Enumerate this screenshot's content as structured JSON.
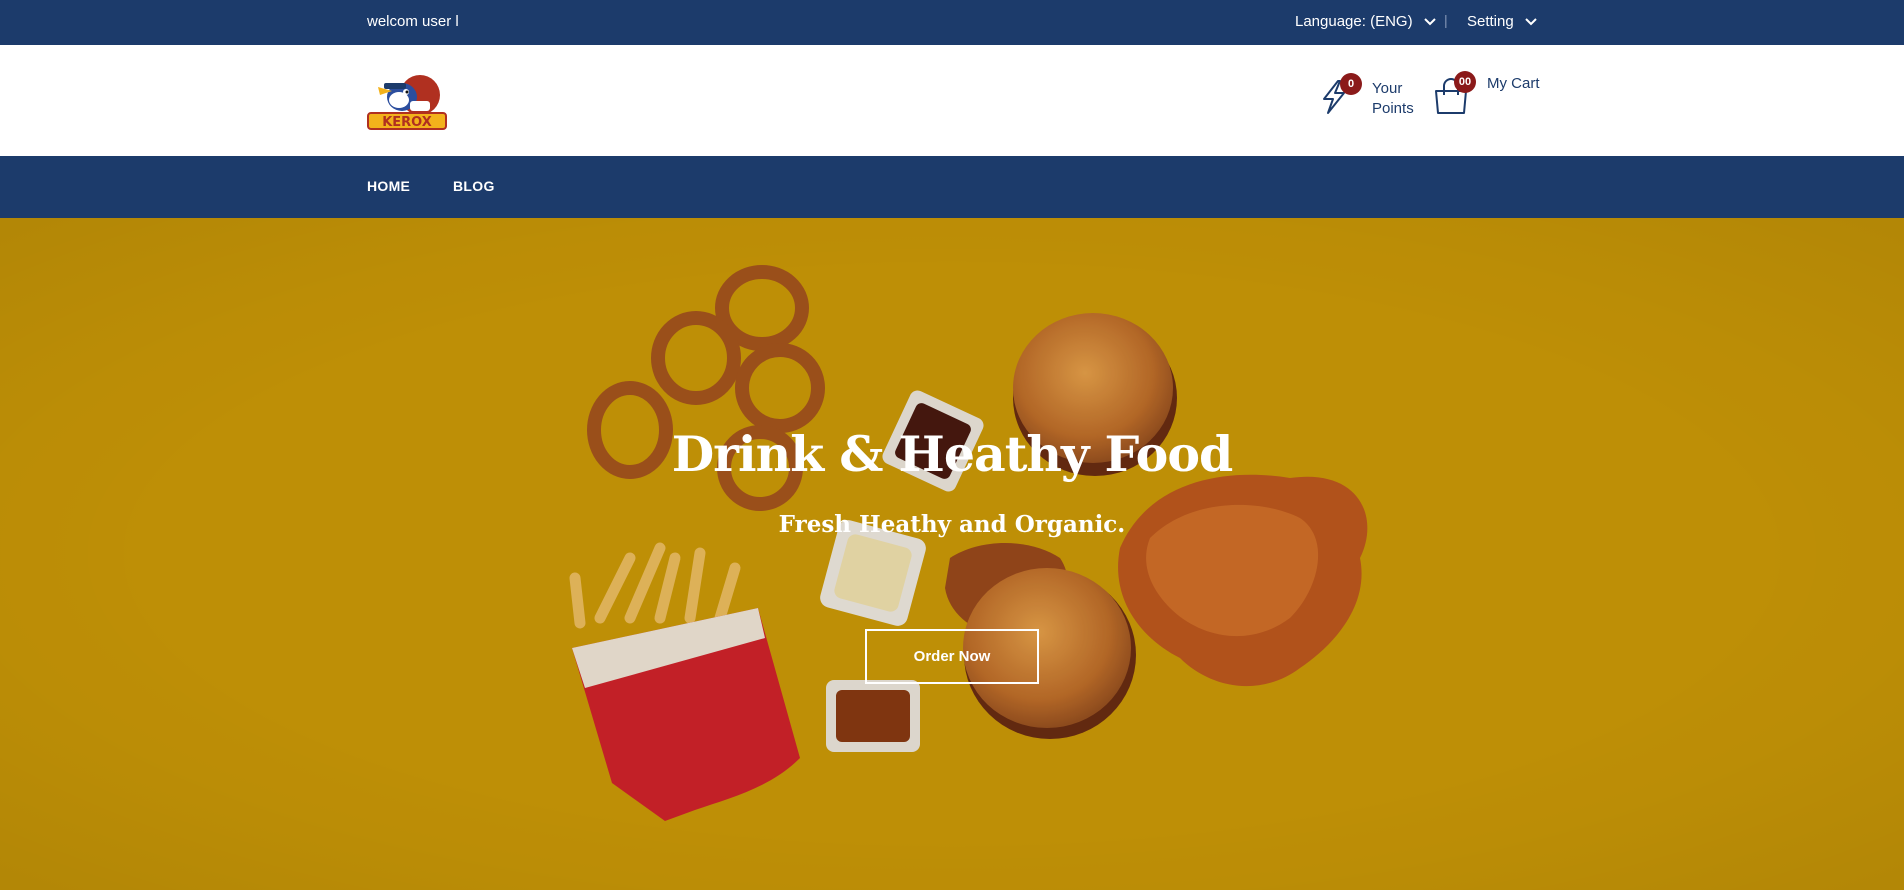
{
  "topbar": {
    "welcome": "welcom user l",
    "language": "Language: (ENG)",
    "separator": "|",
    "setting": "Setting"
  },
  "header": {
    "logo_text": "KEROX",
    "points": {
      "count": "0",
      "label_line1": "Your",
      "label_line2": "Points",
      "icon": "lightning-icon"
    },
    "cart": {
      "count": "00",
      "label": "My Cart",
      "icon": "shopping-bag-icon"
    }
  },
  "nav": {
    "items": [
      {
        "label": "HOME"
      },
      {
        "label": "BLOG"
      }
    ]
  },
  "hero": {
    "title": "Drink & Heathy Food",
    "subtitle": "Fresh Heathy and Organic.",
    "button_label": "Order Now"
  },
  "colors": {
    "primary": "#1c3b6b",
    "hero_background": "#cf9c07",
    "badge": "#8b1a1a",
    "text_light": "#ffffff"
  }
}
